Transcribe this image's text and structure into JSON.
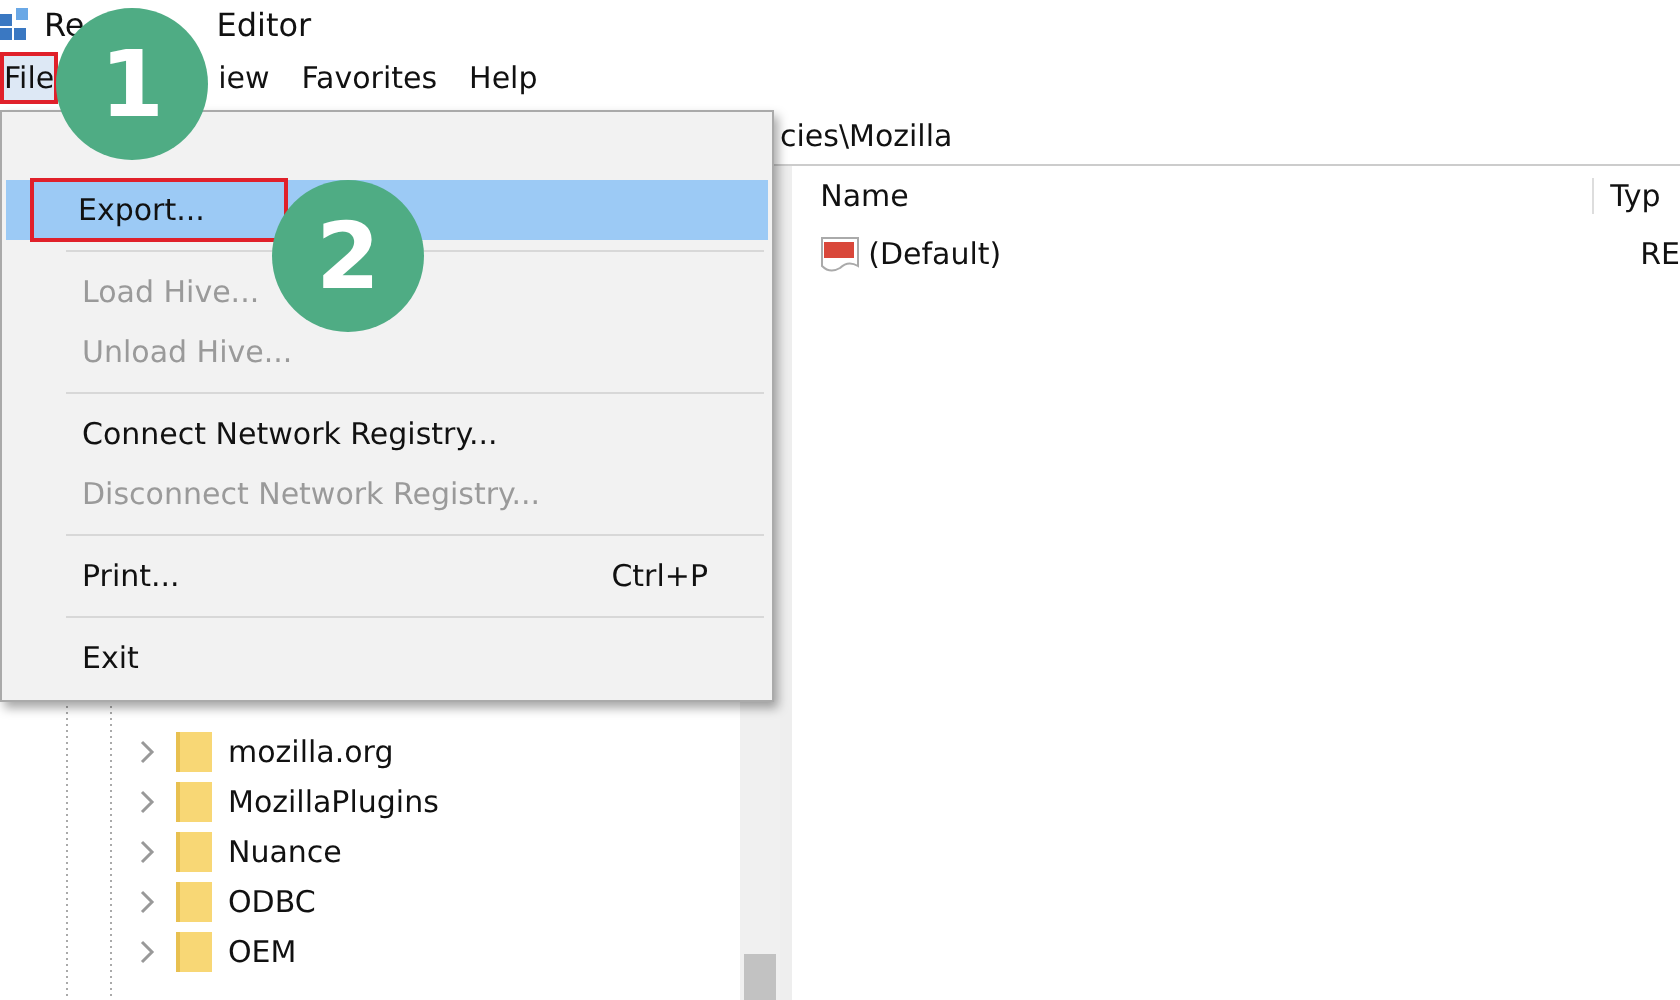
{
  "window": {
    "title_start": "Re",
    "title_end": "Editor"
  },
  "menu_bar": [
    {
      "label": "File",
      "selected": true,
      "highlighted": true
    },
    {
      "label": "iew",
      "selected": false,
      "highlighted": false
    },
    {
      "label": "Favorites",
      "selected": false,
      "highlighted": false
    },
    {
      "label": "Help",
      "selected": false,
      "highlighted": false
    }
  ],
  "address_bar": {
    "value": "cies\\Mozilla"
  },
  "file_menu": [
    {
      "kind": "item",
      "label": "Export...",
      "disabled": false,
      "selected": true,
      "highlighted": true
    },
    {
      "kind": "separator"
    },
    {
      "kind": "item",
      "label": "Load Hive...",
      "disabled": true,
      "selected": false,
      "highlighted": false
    },
    {
      "kind": "item",
      "label": "Unload Hive...",
      "disabled": true,
      "selected": false,
      "highlighted": false
    },
    {
      "kind": "separator"
    },
    {
      "kind": "item",
      "label": "Connect Network Registry...",
      "disabled": false,
      "selected": false,
      "highlighted": false
    },
    {
      "kind": "item",
      "label": "Disconnect Network Registry...",
      "disabled": true,
      "selected": false,
      "highlighted": false
    },
    {
      "kind": "separator"
    },
    {
      "kind": "item",
      "label": "Print...",
      "shortcut": "Ctrl+P",
      "disabled": false,
      "selected": false,
      "highlighted": false
    },
    {
      "kind": "separator"
    },
    {
      "kind": "item",
      "label": "Exit",
      "disabled": false,
      "selected": false,
      "highlighted": false
    }
  ],
  "step_badges": [
    "1",
    "2"
  ],
  "tree": [
    {
      "label": "mozilla.org"
    },
    {
      "label": "MozillaPlugins"
    },
    {
      "label": "Nuance"
    },
    {
      "label": "ODBC"
    },
    {
      "label": "OEM"
    }
  ],
  "values_table": {
    "columns": [
      "Name",
      "Typ"
    ],
    "rows": [
      {
        "name": "(Default)",
        "type": "RE"
      }
    ]
  }
}
